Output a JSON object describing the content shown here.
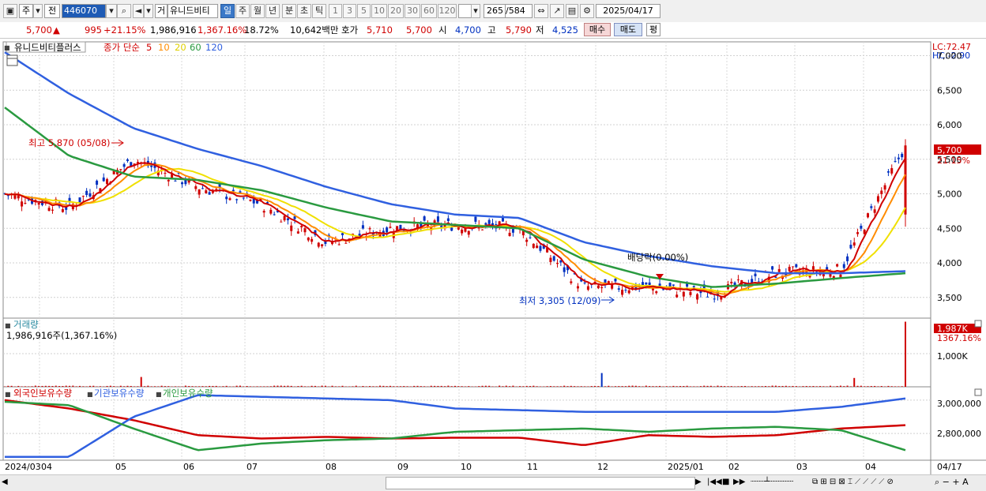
{
  "toolbar": {
    "market": "주",
    "prev_label": "전",
    "code": "446070",
    "name_prefix": "거",
    "stock_name": "유니드비티",
    "periods": [
      "일",
      "주",
      "월",
      "년",
      "분",
      "초",
      "틱"
    ],
    "selected_period": "일",
    "intervals": [
      "1",
      "3",
      "5",
      "10",
      "20",
      "30",
      "60",
      "120"
    ],
    "count_display": "265",
    "count_total": "/584",
    "date": "2025/04/17"
  },
  "infobar": {
    "price": "5,700",
    "change": "995",
    "change_pct": "+21.15%",
    "volume": "1,986,916",
    "volume_ratio": "1,367.16%",
    "turnover": "18.72%",
    "amount": "10,642백만",
    "bid_label": "호가",
    "ask_price": "5,710",
    "bid_price": "5,700",
    "open_label": "시",
    "open": "4,700",
    "high_label": "고",
    "high": "5,790",
    "low_label": "저",
    "low": "4,525",
    "buy_button": "매수",
    "sell_button": "매도",
    "avg_button": "평"
  },
  "price_panel": {
    "legend_name": "유니드비티플러스",
    "legend_close": "종가 단순",
    "ma_labels": [
      "5",
      "10",
      "20",
      "60",
      "120"
    ],
    "lc": "LC:72.47",
    "hc": "HC:-2.90",
    "y_ticks": [
      "7,000",
      "6,500",
      "6,000",
      "5,500",
      "5,000",
      "4,500",
      "4,000",
      "3,500"
    ],
    "current_price_tag": "5,700",
    "current_pct_tag": "21.15%",
    "annotation_high": "최고 5,870 (05/08)",
    "annotation_low": "최저 3,305 (12/09)",
    "annotation_dividend": "배당락(0.00%)"
  },
  "volume_panel": {
    "title": "거래량",
    "value_text": "1,986,916주(1,367.16%)",
    "y_tick": "1,000K",
    "tag_value": "1,987K",
    "tag_pct": "1367.16%"
  },
  "holdings_panel": {
    "series": [
      "외국인보유수량",
      "기관보유수량",
      "개인보유수량"
    ],
    "y_ticks": [
      "3,000,000",
      "2,800,000"
    ]
  },
  "x_axis": {
    "labels": [
      "2024/03",
      "04",
      "05",
      "06",
      "07",
      "08",
      "09",
      "10",
      "11",
      "12",
      "2025/01",
      "02",
      "03",
      "04",
      "04/17"
    ]
  },
  "colors": {
    "up": "#d00000",
    "down": "#0030c0",
    "ma5": "#d00000",
    "ma10": "#ff8c00",
    "ma20": "#f0e000",
    "ma60": "#2a9a40",
    "ma120": "#3060e0"
  },
  "chart_data": {
    "type": "line",
    "title": "유니드비티플러스",
    "x": [
      "2024/03",
      "2024/04",
      "2024/05",
      "2024/06",
      "2024/07",
      "2024/08",
      "2024/09",
      "2024/10",
      "2024/11",
      "2024/12",
      "2025/01",
      "2025/02",
      "2025/03",
      "2025/04",
      "2025/04/17"
    ],
    "series": [
      {
        "name": "종가",
        "values": [
          5000,
          4800,
          5500,
          5100,
          4850,
          4300,
          4500,
          4550,
          4500,
          3650,
          3650,
          3550,
          3850,
          3900,
          5700
        ]
      },
      {
        "name": "60",
        "values": [
          6250,
          5550,
          5250,
          5200,
          5050,
          4800,
          4600,
          4550,
          4500,
          4050,
          3800,
          3650,
          3700,
          3780,
          3850
        ]
      },
      {
        "name": "120",
        "values": [
          7050,
          6450,
          5950,
          5650,
          5400,
          5100,
          4850,
          4700,
          4650,
          4300,
          4100,
          3950,
          3850,
          3850,
          3880
        ]
      }
    ],
    "ylim": [
      3200,
      7200
    ],
    "volume": {
      "ylim": [
        0,
        2000
      ],
      "unit": "K",
      "last": 1987
    },
    "holdings": {
      "ylim": [
        2640000,
        3080000
      ],
      "series": [
        {
          "name": "외국인보유수량",
          "values": [
            3000000,
            2950000,
            2880000,
            2790000,
            2770000,
            2780000,
            2770000,
            2775000,
            2775000,
            2730000,
            2790000,
            2780000,
            2790000,
            2830000,
            2850000
          ]
        },
        {
          "name": "기관보유수량",
          "values": [
            2660000,
            2660000,
            2900000,
            3030000,
            3020000,
            3010000,
            3000000,
            2950000,
            2940000,
            2930000,
            2930000,
            2930000,
            2930000,
            2960000,
            3010000
          ]
        },
        {
          "name": "개인보유수량",
          "values": [
            2990000,
            2970000,
            2830000,
            2700000,
            2740000,
            2760000,
            2770000,
            2810000,
            2820000,
            2830000,
            2810000,
            2830000,
            2840000,
            2820000,
            2700000
          ]
        }
      ]
    }
  }
}
